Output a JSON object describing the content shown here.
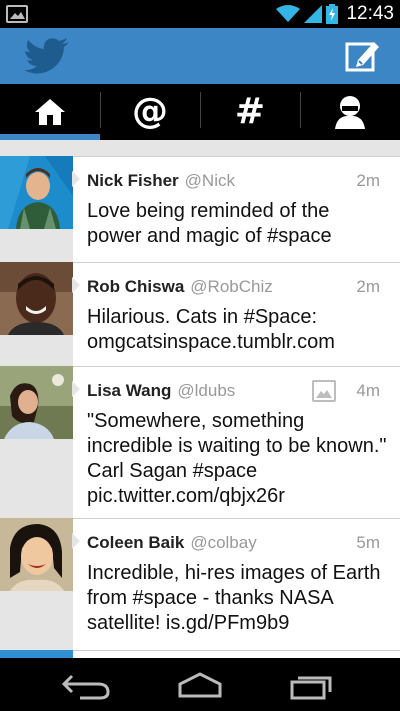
{
  "status_bar": {
    "time": "12:43",
    "icons": [
      "gallery-notification-icon",
      "wifi-icon",
      "cell-signal-icon",
      "battery-charging-icon"
    ]
  },
  "app_bar": {
    "logo_icon": "twitter-bird-icon",
    "compose_icon": "compose-icon",
    "accent_color": "#3d86c6"
  },
  "tabs": [
    {
      "id": "home",
      "icon": "home-icon",
      "glyph": "",
      "active": true
    },
    {
      "id": "connect",
      "icon": "at-icon",
      "glyph": "@",
      "active": false
    },
    {
      "id": "discover",
      "icon": "hashtag-icon",
      "glyph": "#",
      "active": false
    },
    {
      "id": "me",
      "icon": "profile-icon",
      "glyph": "",
      "active": false
    }
  ],
  "timeline": {
    "tweets": [
      {
        "name": "Nick Fisher",
        "handle": "@Nick",
        "time": "2m",
        "text": "Love being reminded of the\npower and magic of #space",
        "has_media": false
      },
      {
        "name": "Rob Chiswa",
        "handle": "@RobChiz",
        "time": "2m",
        "text": "Hilarious. Cats in #Space:\nomgcatsinspace.tumblr.com",
        "has_media": false
      },
      {
        "name": "Lisa Wang",
        "handle": "@ldubs",
        "time": "4m",
        "text": "\"Somewhere, something\nincredible is waiting to be known.\"\nCarl Sagan #space\npic.twitter.com/qbjx26r",
        "has_media": true
      },
      {
        "name": "Coleen Baik",
        "handle": "@colbay",
        "time": "5m",
        "text": "Incredible, hi-res images of Earth\nfrom #space - thanks NASA\nsatellite! is.gd/PFm9b9",
        "has_media": false
      }
    ]
  },
  "nav_bar": {
    "icons": [
      "back-icon",
      "home-nav-icon",
      "recent-apps-icon"
    ]
  }
}
